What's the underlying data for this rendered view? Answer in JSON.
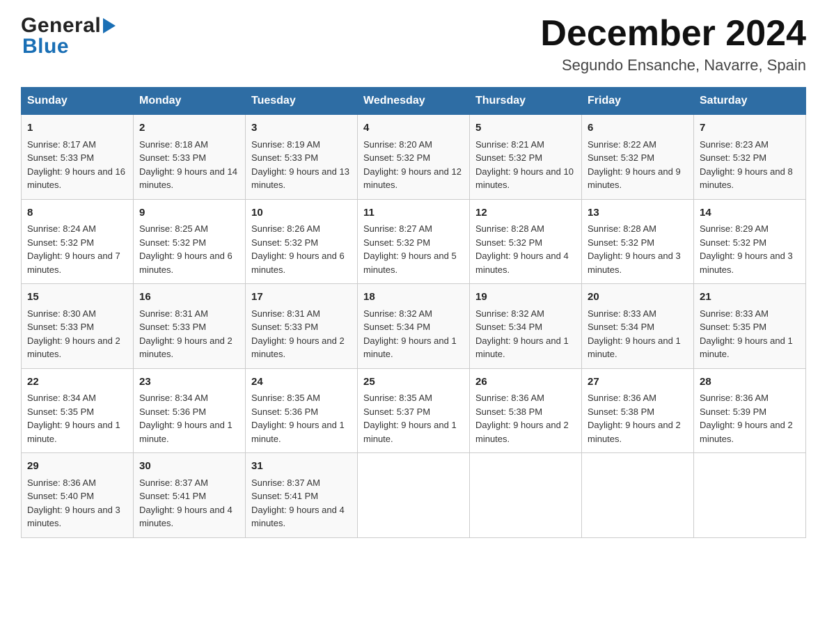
{
  "header": {
    "logo_general": "General",
    "logo_blue": "Blue",
    "month_title": "December 2024",
    "location": "Segundo Ensanche, Navarre, Spain"
  },
  "weekdays": [
    "Sunday",
    "Monday",
    "Tuesday",
    "Wednesday",
    "Thursday",
    "Friday",
    "Saturday"
  ],
  "weeks": [
    [
      {
        "day": "1",
        "sunrise": "8:17 AM",
        "sunset": "5:33 PM",
        "daylight": "9 hours and 16 minutes."
      },
      {
        "day": "2",
        "sunrise": "8:18 AM",
        "sunset": "5:33 PM",
        "daylight": "9 hours and 14 minutes."
      },
      {
        "day": "3",
        "sunrise": "8:19 AM",
        "sunset": "5:33 PM",
        "daylight": "9 hours and 13 minutes."
      },
      {
        "day": "4",
        "sunrise": "8:20 AM",
        "sunset": "5:32 PM",
        "daylight": "9 hours and 12 minutes."
      },
      {
        "day": "5",
        "sunrise": "8:21 AM",
        "sunset": "5:32 PM",
        "daylight": "9 hours and 10 minutes."
      },
      {
        "day": "6",
        "sunrise": "8:22 AM",
        "sunset": "5:32 PM",
        "daylight": "9 hours and 9 minutes."
      },
      {
        "day": "7",
        "sunrise": "8:23 AM",
        "sunset": "5:32 PM",
        "daylight": "9 hours and 8 minutes."
      }
    ],
    [
      {
        "day": "8",
        "sunrise": "8:24 AM",
        "sunset": "5:32 PM",
        "daylight": "9 hours and 7 minutes."
      },
      {
        "day": "9",
        "sunrise": "8:25 AM",
        "sunset": "5:32 PM",
        "daylight": "9 hours and 6 minutes."
      },
      {
        "day": "10",
        "sunrise": "8:26 AM",
        "sunset": "5:32 PM",
        "daylight": "9 hours and 6 minutes."
      },
      {
        "day": "11",
        "sunrise": "8:27 AM",
        "sunset": "5:32 PM",
        "daylight": "9 hours and 5 minutes."
      },
      {
        "day": "12",
        "sunrise": "8:28 AM",
        "sunset": "5:32 PM",
        "daylight": "9 hours and 4 minutes."
      },
      {
        "day": "13",
        "sunrise": "8:28 AM",
        "sunset": "5:32 PM",
        "daylight": "9 hours and 3 minutes."
      },
      {
        "day": "14",
        "sunrise": "8:29 AM",
        "sunset": "5:32 PM",
        "daylight": "9 hours and 3 minutes."
      }
    ],
    [
      {
        "day": "15",
        "sunrise": "8:30 AM",
        "sunset": "5:33 PM",
        "daylight": "9 hours and 2 minutes."
      },
      {
        "day": "16",
        "sunrise": "8:31 AM",
        "sunset": "5:33 PM",
        "daylight": "9 hours and 2 minutes."
      },
      {
        "day": "17",
        "sunrise": "8:31 AM",
        "sunset": "5:33 PM",
        "daylight": "9 hours and 2 minutes."
      },
      {
        "day": "18",
        "sunrise": "8:32 AM",
        "sunset": "5:34 PM",
        "daylight": "9 hours and 1 minute."
      },
      {
        "day": "19",
        "sunrise": "8:32 AM",
        "sunset": "5:34 PM",
        "daylight": "9 hours and 1 minute."
      },
      {
        "day": "20",
        "sunrise": "8:33 AM",
        "sunset": "5:34 PM",
        "daylight": "9 hours and 1 minute."
      },
      {
        "day": "21",
        "sunrise": "8:33 AM",
        "sunset": "5:35 PM",
        "daylight": "9 hours and 1 minute."
      }
    ],
    [
      {
        "day": "22",
        "sunrise": "8:34 AM",
        "sunset": "5:35 PM",
        "daylight": "9 hours and 1 minute."
      },
      {
        "day": "23",
        "sunrise": "8:34 AM",
        "sunset": "5:36 PM",
        "daylight": "9 hours and 1 minute."
      },
      {
        "day": "24",
        "sunrise": "8:35 AM",
        "sunset": "5:36 PM",
        "daylight": "9 hours and 1 minute."
      },
      {
        "day": "25",
        "sunrise": "8:35 AM",
        "sunset": "5:37 PM",
        "daylight": "9 hours and 1 minute."
      },
      {
        "day": "26",
        "sunrise": "8:36 AM",
        "sunset": "5:38 PM",
        "daylight": "9 hours and 2 minutes."
      },
      {
        "day": "27",
        "sunrise": "8:36 AM",
        "sunset": "5:38 PM",
        "daylight": "9 hours and 2 minutes."
      },
      {
        "day": "28",
        "sunrise": "8:36 AM",
        "sunset": "5:39 PM",
        "daylight": "9 hours and 2 minutes."
      }
    ],
    [
      {
        "day": "29",
        "sunrise": "8:36 AM",
        "sunset": "5:40 PM",
        "daylight": "9 hours and 3 minutes."
      },
      {
        "day": "30",
        "sunrise": "8:37 AM",
        "sunset": "5:41 PM",
        "daylight": "9 hours and 4 minutes."
      },
      {
        "day": "31",
        "sunrise": "8:37 AM",
        "sunset": "5:41 PM",
        "daylight": "9 hours and 4 minutes."
      },
      null,
      null,
      null,
      null
    ]
  ],
  "labels": {
    "sunrise": "Sunrise:",
    "sunset": "Sunset:",
    "daylight": "Daylight:"
  }
}
